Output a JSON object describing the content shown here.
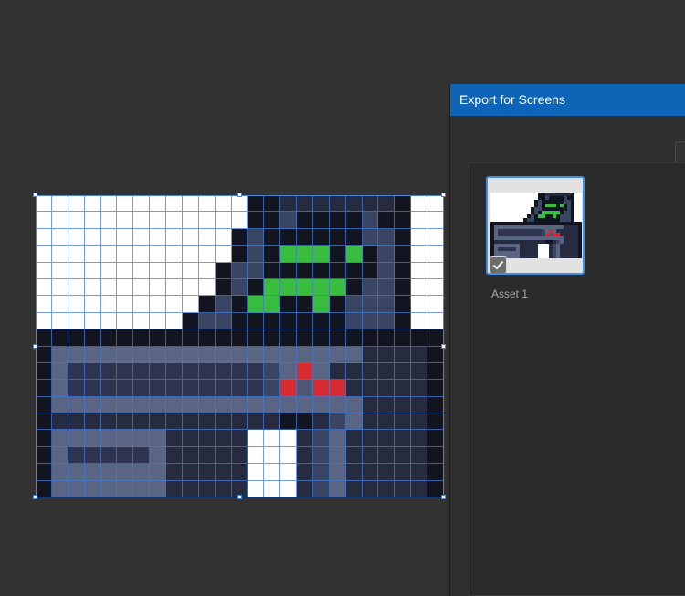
{
  "canvas": {
    "artboard": {
      "columns": 25,
      "rows": 18,
      "palette": {
        "W": "#ffffff",
        "K": "#12141f",
        "D": "#262b40",
        "M": "#3a4463",
        "B": "#2f3550",
        "S": "#4d5775",
        "L": "#5a6584",
        "G": "#39bd3f",
        "R": "#d62b31"
      },
      "pixels": [
        "WWWWWWWWWWWWWKKDDDDDDDKWW",
        "WWWWWWWWWWWWWKKMKKKKMKKWW",
        "WWWWWWWWWWWWKMKKKKKKMMKWW",
        "WWWWWWWWWWWWKMKGGGKGKMKWW",
        "WWWWWWWWWWWKMMKKKKKKKMKWW",
        "WWWWWWWWWWWKMKGGGGGKMMKWW",
        "WWWWWWWWWWKMKGGKKGKMMMKWW",
        "WWWWWWWWWKMMKKKKKKKMMMKWW",
        "KKKKKKKKKKKKKKKKKKKKKKKKK",
        "KLLLLLLLLLLLLLLLLLLLDDDDK",
        "KLBBBBBBBBBBBBMLRLDDDDDDK",
        "KLBBBBBBBBBBBBMRSRRDDDDDK",
        "KLLLLLLLLLLLLLLLLLLLDDDDK",
        "KDDDDDDDDDDDDDDKKDMLDDDDK",
        "KLLLLLLLDDDDDWWWDMLDDDDDK",
        "KLBBBBBLDDDDDWWWDMLDDDDDK",
        "KLLLLLLLDDDDDWWWDMLDDDDDK",
        "KLLLLLLLDDDDDWWWDMLDDDDDK"
      ]
    }
  },
  "panel": {
    "title": "Export for Screens",
    "asset": {
      "label": "Asset 1",
      "checked": true
    }
  },
  "colors": {
    "titlebar": "#0e64b6",
    "selection": "#4a82d6",
    "background": "#323232"
  }
}
